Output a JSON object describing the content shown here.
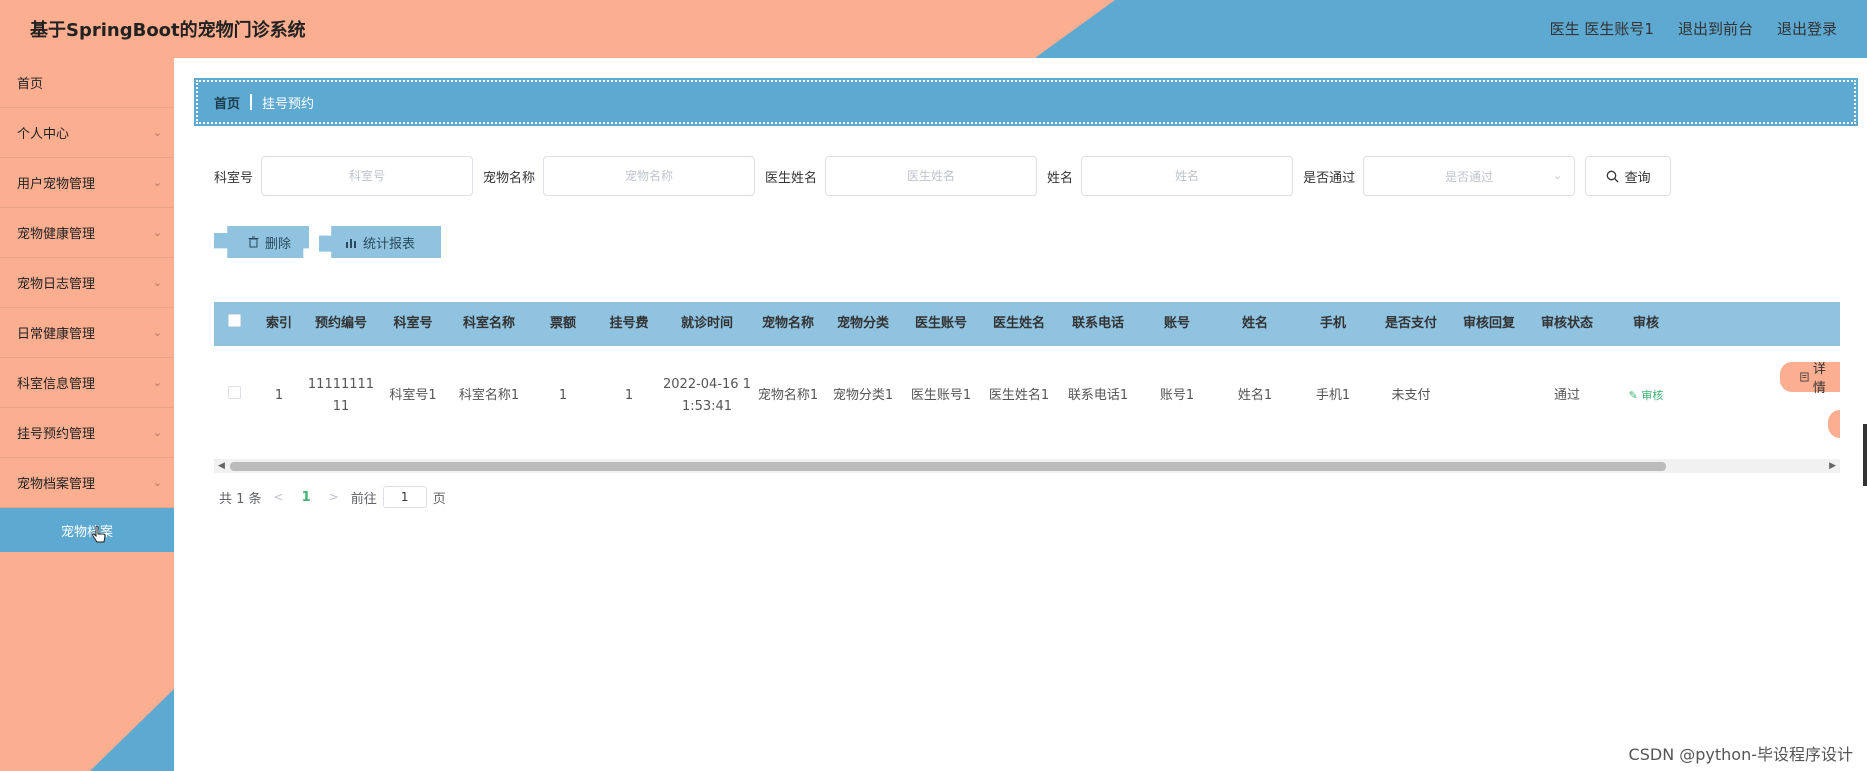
{
  "header": {
    "title": "基于SpringBoot的宠物门诊系统",
    "user": "医生 医生账号1",
    "to_front": "退出到前台",
    "logout": "退出登录"
  },
  "sidebar": {
    "items": [
      {
        "label": "首页",
        "has_arrow": false
      },
      {
        "label": "个人中心",
        "has_arrow": true
      },
      {
        "label": "用户宠物管理",
        "has_arrow": true
      },
      {
        "label": "宠物健康管理",
        "has_arrow": true
      },
      {
        "label": "宠物日志管理",
        "has_arrow": true
      },
      {
        "label": "日常健康管理",
        "has_arrow": true
      },
      {
        "label": "科室信息管理",
        "has_arrow": true
      },
      {
        "label": "挂号预约管理",
        "has_arrow": true
      },
      {
        "label": "宠物档案管理",
        "has_arrow": true
      }
    ],
    "active_sub": "宠物档案"
  },
  "breadcrumb": {
    "home": "首页",
    "current": "挂号预约"
  },
  "search": {
    "dept_no_label": "科室号",
    "dept_no_placeholder": "科室号",
    "pet_name_label": "宠物名称",
    "pet_name_placeholder": "宠物名称",
    "doctor_name_label": "医生姓名",
    "doctor_name_placeholder": "医生姓名",
    "name_label": "姓名",
    "name_placeholder": "姓名",
    "passed_label": "是否通过",
    "passed_placeholder": "是否通过",
    "query_button": "查询"
  },
  "actions": {
    "delete": "删除",
    "report": "统计报表"
  },
  "table": {
    "columns": [
      "索引",
      "预约编号",
      "科室号",
      "科室名称",
      "票额",
      "挂号费",
      "就诊时间",
      "宠物名称",
      "宠物分类",
      "医生账号",
      "医生姓名",
      "联系电话",
      "账号",
      "姓名",
      "手机",
      "是否支付",
      "审核回复",
      "审核状态",
      "审核"
    ],
    "rows": [
      [
        "1",
        "1111111111",
        "科室号1",
        "科室名称1",
        "1",
        "1",
        "2022-04-16 11:53:41",
        "宠物名称1",
        "宠物分类1",
        "医生账号1",
        "医生姓名1",
        "联系电话1",
        "账号1",
        "姓名1",
        "手机1",
        "未支付",
        "",
        "通过",
        "审核"
      ]
    ],
    "detail_button": "详情"
  },
  "pager": {
    "total": "共 1 条",
    "page": "1",
    "goto": "前往",
    "goto_value": "1",
    "page_unit": "页"
  },
  "watermark": "CSDN @python-毕设程序设计",
  "colors": {
    "salmon": "#fcae91",
    "blue": "#5da9d1",
    "light_blue": "#8fc3e0",
    "green": "#3cb371"
  }
}
